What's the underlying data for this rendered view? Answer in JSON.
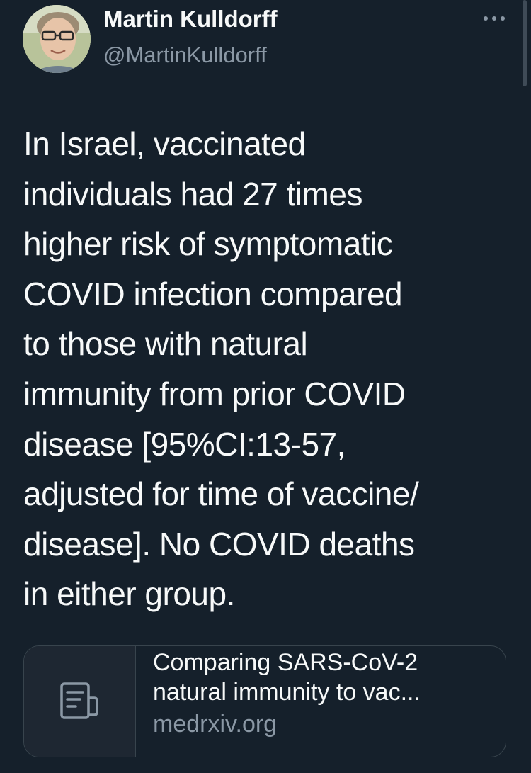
{
  "author": {
    "display_name": "Martin Kulldorff",
    "handle": "@MartinKulldorff"
  },
  "tweet": {
    "lines": [
      "In Israel, vaccinated",
      "individuals had 27 times",
      "higher risk of symptomatic",
      "COVID infection compared",
      "to those with natural",
      "immunity from prior COVID",
      "disease [95%CI:13-57,",
      "adjusted for time of vaccine/",
      "disease]. No COVID deaths",
      "in either group."
    ]
  },
  "link_card": {
    "title_lines": [
      "Comparing SARS-CoV-2",
      "natural immunity to vac..."
    ],
    "domain": "medrxiv.org",
    "icon": "document-icon"
  },
  "icons": {
    "more": "more-dots-icon"
  },
  "colors": {
    "background": "#15202b",
    "text": "#f7f9f9",
    "secondary_text": "#8b98a5",
    "border": "#38444d"
  }
}
